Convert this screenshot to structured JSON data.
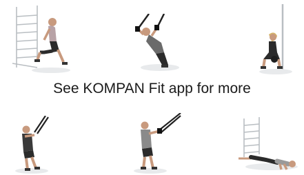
{
  "caption": "See KOMPAN Fit app for more",
  "exercises": [
    {
      "name": "wall-bar-lunge",
      "position": "top-left"
    },
    {
      "name": "trx-row",
      "position": "top-center"
    },
    {
      "name": "kettlebell-squat",
      "position": "top-right"
    },
    {
      "name": "trx-chest-pull",
      "position": "bottom-left"
    },
    {
      "name": "trx-row-standing",
      "position": "bottom-center"
    },
    {
      "name": "incline-pushup",
      "position": "bottom-right"
    }
  ]
}
